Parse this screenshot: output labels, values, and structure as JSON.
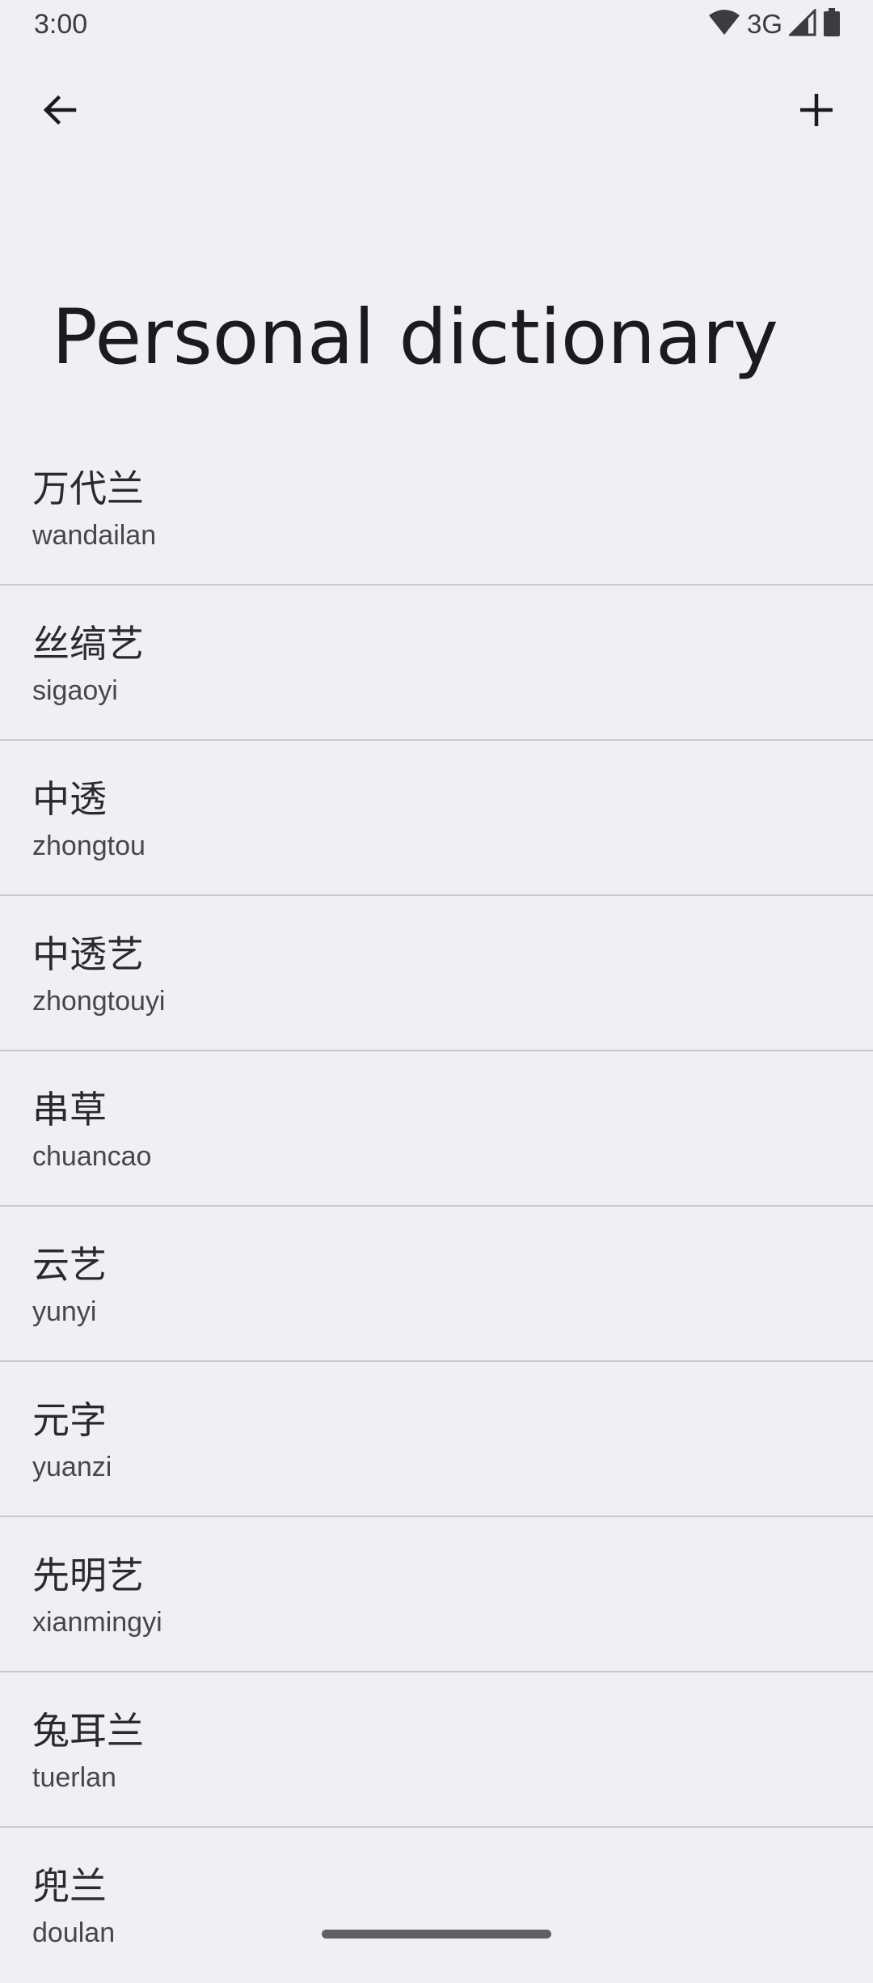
{
  "status_bar": {
    "time": "3:00",
    "network": "3G",
    "icons": [
      "wifi-icon",
      "cell-signal-icon",
      "battery-icon"
    ]
  },
  "top_bar": {
    "back_icon": "arrow-back-icon",
    "add_icon": "plus-icon"
  },
  "page": {
    "title": "Personal dictionary"
  },
  "words": [
    {
      "word": "万代兰",
      "shortcut": "wandailan"
    },
    {
      "word": "丝缟艺",
      "shortcut": "sigaoyi"
    },
    {
      "word": "中透",
      "shortcut": "zhongtou"
    },
    {
      "word": "中透艺",
      "shortcut": "zhongtouyi"
    },
    {
      "word": "串草",
      "shortcut": "chuancao"
    },
    {
      "word": "云艺",
      "shortcut": "yunyi"
    },
    {
      "word": "元字",
      "shortcut": "yuanzi"
    },
    {
      "word": "先明艺",
      "shortcut": "xianmingyi"
    },
    {
      "word": "兔耳兰",
      "shortcut": "tuerlan"
    },
    {
      "word": "兜兰",
      "shortcut": "doulan"
    }
  ],
  "colors": {
    "background": "#f0eff5",
    "divider": "#c9c8ce",
    "text_primary": "#1b1b1f",
    "text_secondary": "#46464c"
  }
}
